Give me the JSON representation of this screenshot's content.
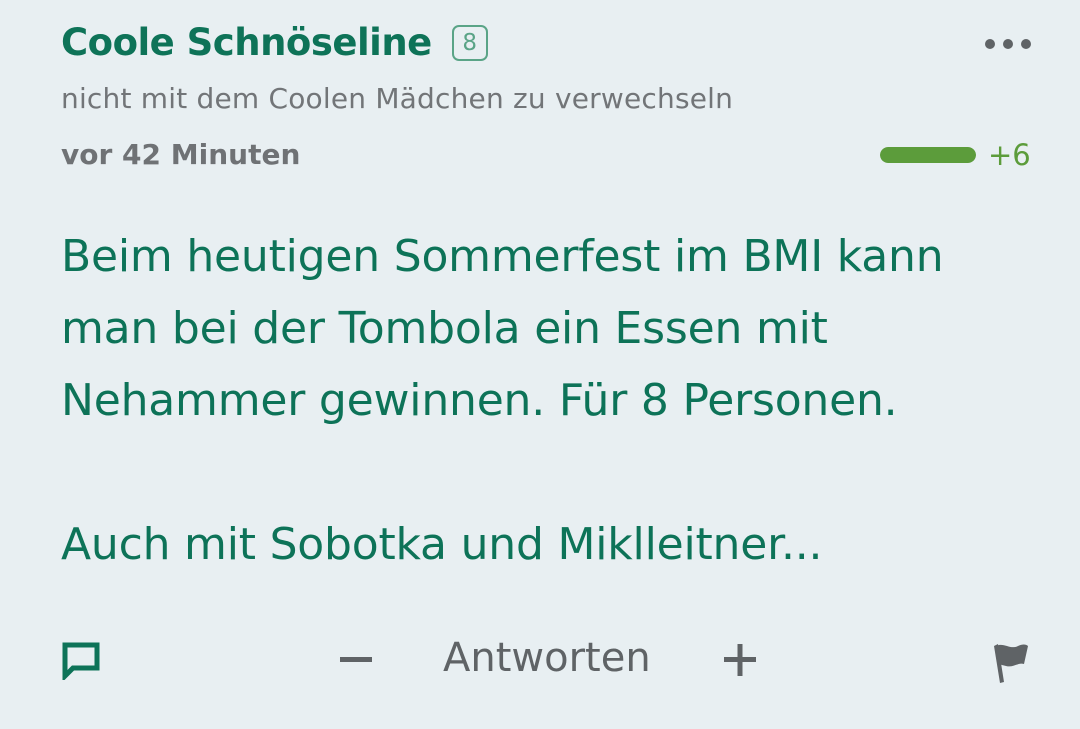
{
  "post": {
    "author": "Coole Schnöseline",
    "level": "8",
    "subtitle": "nicht mit dem Coolen Mädchen zu verwechseln",
    "timestamp": "vor 42 Minuten",
    "rating_score": "+6",
    "rating_fraction": 1.0,
    "body": [
      "Beim heutigen Sommerfest im BMI kann man bei der Tombola ein Essen mit Nehammer gewinnen. Für 8 Personen.",
      "Auch mit Sobotka und Miklleitner..."
    ]
  },
  "actions": {
    "reply_icon": "comment-icon",
    "minus_icon": "minus-icon",
    "answer_label": "Antworten",
    "plus_icon": "plus-icon",
    "flag_icon": "flag-icon",
    "more_icon": "more-dots-icon"
  },
  "colors": {
    "background": "#e8eff2",
    "brand_green": "#0d7358",
    "rating_green": "#5c9c3b",
    "muted_text": "#727578"
  }
}
